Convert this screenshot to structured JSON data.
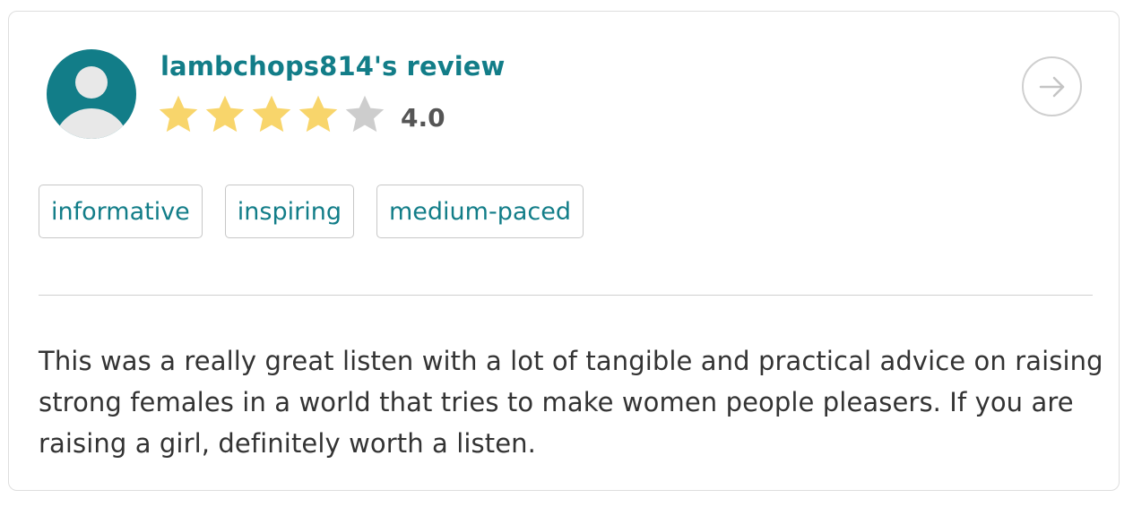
{
  "review": {
    "title": "lambchops814's review",
    "rating": 4,
    "rating_max": 5,
    "rating_text": "4.0",
    "colors": {
      "accent": "#127d88",
      "star_filled": "#f8d56b",
      "star_empty": "#cdcdcd"
    },
    "tags": [
      "informative",
      "inspiring",
      "medium-paced"
    ],
    "body": "This was a really great listen with a lot of tangible and practical advice on raising strong females in a world that tries to make women people pleasers. If you are raising a girl, definitely worth a listen.",
    "icons": {
      "avatar": "user-avatar-icon",
      "next": "arrow-right-icon",
      "star": "star-icon"
    }
  }
}
